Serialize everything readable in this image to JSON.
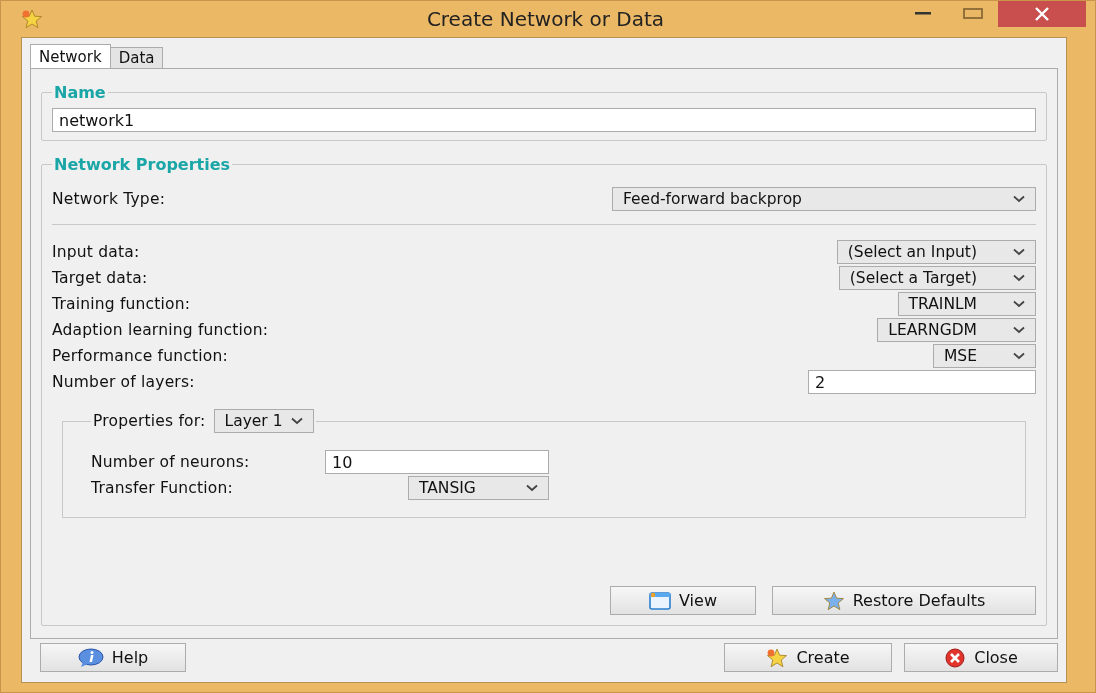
{
  "window": {
    "title": "Create Network or Data"
  },
  "tabs": [
    {
      "label": "Network",
      "selected": true
    },
    {
      "label": "Data",
      "selected": false
    }
  ],
  "name_group": {
    "legend": "Name",
    "value": "network1"
  },
  "properties": {
    "legend": "Network Properties",
    "network_type": {
      "label": "Network Type:",
      "value": "Feed-forward backprop"
    },
    "rows": [
      {
        "kind": "dropdown",
        "label": "Input data:",
        "value": "(Select an Input)"
      },
      {
        "kind": "dropdown",
        "label": "Target data:",
        "value": "(Select a Target)"
      },
      {
        "kind": "dropdown",
        "label": "Training function:",
        "value": "TRAINLM"
      },
      {
        "kind": "dropdown",
        "label": "Adaption learning function:",
        "value": "LEARNGDM"
      },
      {
        "kind": "dropdown",
        "label": "Performance function:",
        "value": "MSE"
      },
      {
        "kind": "input",
        "label": "Number of layers:",
        "value": "2"
      }
    ],
    "layer_group": {
      "legend": "Properties for:",
      "layer": "Layer 1",
      "neurons": {
        "label": "Number of neurons:",
        "value": "10"
      },
      "transfer": {
        "label": "Transfer Function:",
        "value": "TANSIG"
      }
    },
    "buttons": [
      {
        "kind": "view",
        "label": "View"
      },
      {
        "kind": "restore",
        "label": "Restore Defaults"
      }
    ]
  },
  "footer": {
    "buttons": [
      {
        "kind": "help",
        "label": "Help"
      },
      {
        "kind": "create",
        "label": "Create"
      },
      {
        "kind": "close",
        "label": "Close"
      }
    ]
  }
}
